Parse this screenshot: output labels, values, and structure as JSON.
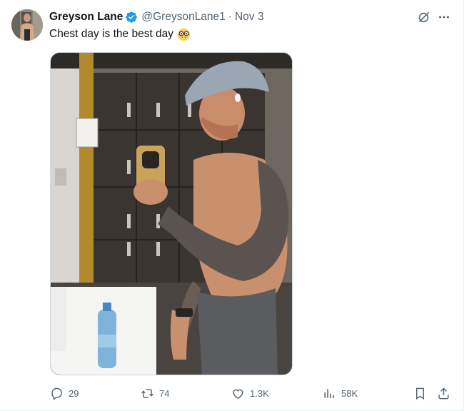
{
  "tweet": {
    "author": {
      "display_name": "Greyson Lane",
      "handle": "@GreysonLane1",
      "verified": true,
      "verified_color": "#1d9bf0"
    },
    "separator": "·",
    "date": "Nov 3",
    "text": "Chest day is the best day",
    "emoji": "nerd-face-emoji",
    "media": {
      "description_icon": "photo"
    },
    "actions": {
      "replies": "29",
      "reposts": "74",
      "likes": "1.3K",
      "views": "58K"
    }
  },
  "icons": {
    "verified": "verified-badge-icon",
    "grok": "grok-icon",
    "more": "more-icon",
    "reply": "reply-icon",
    "repost": "repost-icon",
    "like": "heart-icon",
    "views": "views-icon",
    "bookmark": "bookmark-icon",
    "share": "share-icon"
  },
  "colors": {
    "text": "#0f1419",
    "secondary": "#536471",
    "accent": "#1d9bf0"
  }
}
